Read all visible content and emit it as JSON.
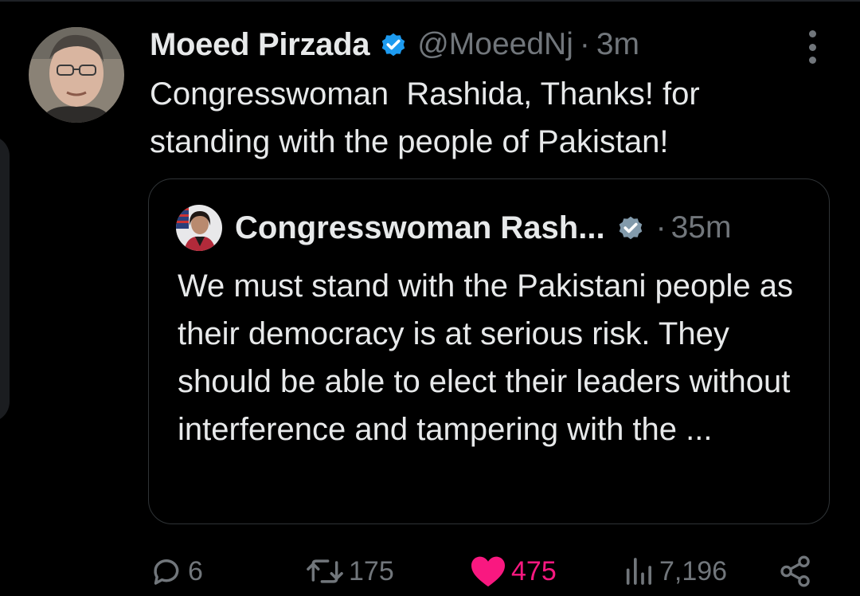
{
  "tweet": {
    "author_name": "Moeed Pirzada",
    "handle": "@MoeedNj",
    "separator": "·",
    "time": "3m",
    "text": "Congresswoman  Rashida, Thanks! for standing with the people of Pakistan!",
    "avatar_icon": "person-photo-avatar",
    "verified_icon": "verified-badge-icon",
    "more_icon": "more-options-icon"
  },
  "quote": {
    "author_name": "Congresswoman Rash...",
    "separator": "·",
    "time": "35m",
    "text": "We must stand with the Pakistani people as their democracy is at serious risk. They should be able to elect their leaders without interference and tampering with the ...",
    "verified_icon": "gray-verified-badge-icon"
  },
  "actions": {
    "replies": "6",
    "retweets": "175",
    "likes": "475",
    "views": "7,196"
  },
  "colors": {
    "background": "#000000",
    "text": "#e7e9ea",
    "muted": "#71767b",
    "verified_blue": "#1d9bf0",
    "like_pink": "#f91880",
    "border": "#2f3336"
  }
}
